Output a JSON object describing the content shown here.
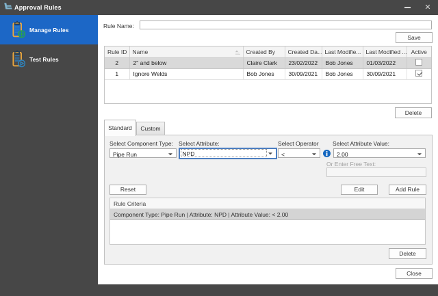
{
  "window": {
    "title": "Approval Rules",
    "minimize_glyph": "",
    "close_glyph": "✕"
  },
  "sidebar": {
    "items": [
      {
        "label": "Manage Rules",
        "selected": true
      },
      {
        "label": "Test Rules",
        "selected": false
      }
    ]
  },
  "form_top": {
    "rule_name_label": "Rule Name:",
    "rule_name_value": "",
    "save_label": "Save"
  },
  "grid": {
    "columns": [
      "Rule ID",
      "Name",
      "Created By",
      "Created Da...",
      "Last Modifie...",
      "Last Modified ...",
      "Active"
    ],
    "rows": [
      {
        "rule_id": "2",
        "name": "2\" and below",
        "created_by": "Claire Clark",
        "created_date": "23/02/2022",
        "last_modified_by": "Bob Jones",
        "last_modified_date": "01/03/2022",
        "active": false,
        "selected": true
      },
      {
        "rule_id": "1",
        "name": "Ignore Welds",
        "created_by": "Bob Jones",
        "created_date": "30/09/2021",
        "last_modified_by": "Bob Jones",
        "last_modified_date": "30/09/2021",
        "active": true,
        "selected": false
      }
    ],
    "delete_label": "Delete"
  },
  "tabs": [
    {
      "label": "Standard",
      "selected": true
    },
    {
      "label": "Custom",
      "selected": false
    }
  ],
  "rule_builder": {
    "component_type_label": "Select Component Type:",
    "component_type_value": "Pipe Run",
    "attribute_label": "Select Attribute:",
    "attribute_value": "NPD",
    "operator_label": "Select Operator",
    "operator_value": "<",
    "attribute_value_label": "Select Attribute Value:",
    "attribute_value_value": "2.00",
    "free_text_label": "Or Enter Free Text:",
    "free_text_value": "",
    "reset_label": "Reset",
    "edit_label": "Edit",
    "add_rule_label": "Add Rule",
    "criteria_header": "Rule Criteria",
    "criteria_rows": [
      "Component Type: Pipe Run | Attribute: NPD | Attribute Value: < 2.00"
    ],
    "delete_label": "Delete"
  },
  "footer": {
    "close_label": "Close"
  },
  "colors": {
    "chrome": "#474747",
    "accent": "#1c67c6",
    "info_blue": "#1467c0"
  }
}
